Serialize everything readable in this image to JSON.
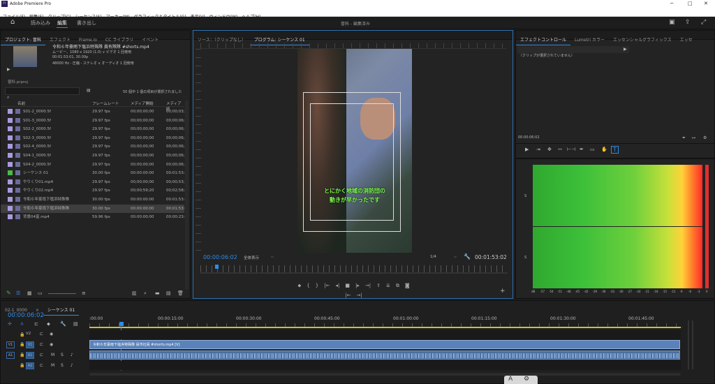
{
  "app": {
    "title": "Adobe Premiere Pro",
    "logo": "Pr"
  },
  "menus": [
    "ファイル(F)",
    "編集(E)",
    "クリップ(C)",
    "シーケンス(S)",
    "マーカー(M)",
    "グラフィックとタイトル(G)",
    "表示(V)",
    "ウィンドウ(W)",
    "ヘルプ(H)"
  ],
  "workspaces": [
    "読み込み",
    "編集",
    "書き出し"
  ],
  "active_workspace": "編集",
  "project_title": "曽科 - 編集済み",
  "project_panel": {
    "tabs": [
      "プロジェクト: 曽科",
      "エフェクト",
      "Frame.io",
      "CC ライブラリ",
      "イベント"
    ],
    "clip_name": "令和６年豪雨下塩浜特殊隊 員有隊隊 #shorts.mp4",
    "clip_info": [
      "ムービー、1080 x 1920 (1.0) ∨ ビデオ 1 回使用",
      "00:01:53:01, 30.00p",
      "48000 Hz - 圧縮 - ステレオ ∨ オーディオ 1 回使用"
    ],
    "project_file": "曽科.prproj",
    "status": "50 個中 1 個の項目が選択されました",
    "columns": [
      "名前",
      "フレームレート",
      "メディア開始",
      "メディア終"
    ],
    "items": [
      {
        "name": "S01-2_0000.5f",
        "fps": "29.97 fps",
        "start": "00;00;00;00",
        "end": "00;00;03;1",
        "color": "#a99ae0"
      },
      {
        "name": "S01-3_0000.5f",
        "fps": "29.97 fps",
        "start": "00;00;00;00",
        "end": "00;00;06;1",
        "color": "#a99ae0"
      },
      {
        "name": "S02-2_0000.5f",
        "fps": "29.97 fps",
        "start": "00;00;00;00",
        "end": "00;00;06;1",
        "color": "#a99ae0"
      },
      {
        "name": "S02-3_0000.5f",
        "fps": "29.97 fps",
        "start": "00;00;00;00",
        "end": "00;00;06;1",
        "color": "#a99ae0"
      },
      {
        "name": "S02-4_0000.5f",
        "fps": "29.97 fps",
        "start": "00;00;00;00",
        "end": "00;00;06;1",
        "color": "#a99ae0"
      },
      {
        "name": "S04-1_0000.5f",
        "fps": "29.97 fps",
        "start": "00;00;00;00",
        "end": "00;00;06;1",
        "color": "#a99ae0"
      },
      {
        "name": "S04-2_0000.5f",
        "fps": "29.97 fps",
        "start": "00;00;00;00",
        "end": "00;00;06;1",
        "color": "#a99ae0"
      },
      {
        "name": "シーケンス 01",
        "fps": "30.00 fps",
        "start": "00:00:00:00",
        "end": "00:01:53:0",
        "color": "#4ab84a"
      },
      {
        "name": "やりくり01.mp4",
        "fps": "29.97 fps",
        "start": "00;00;00;00",
        "end": "00;00;53;1",
        "color": "#a99ae0"
      },
      {
        "name": "やりくり02.mp4",
        "fps": "29.97 fps",
        "start": "00;00;59;20",
        "end": "00;02;58;0",
        "color": "#a99ae0"
      },
      {
        "name": "令和６年豪雨下塩浜特殊隊",
        "fps": "30.00 fps",
        "start": "00:00:00:00",
        "end": "00:01:53:0",
        "color": "#a99ae0"
      },
      {
        "name": "令和６年豪雨下塩浜特殊隊",
        "fps": "30.00 fps",
        "start": "00:00:00:00",
        "end": "00:01:53:0",
        "color": "#a99ae0",
        "selected": true
      },
      {
        "name": "背景04富.mp4",
        "fps": "59.96 fps",
        "start": "00:00:00:00",
        "end": "00:00:23:0",
        "color": "#a99ae0"
      }
    ]
  },
  "source_tab": "ソース：（クリップなし）",
  "program_tab": "プログラム: シーケンス 01",
  "program": {
    "timecode": "00:00:06:02",
    "fit": "全体表示",
    "quality": "1/4",
    "duration": "00:01:53:02",
    "caption_line1": "とにかく地域の消防団の",
    "caption_line2": "動きが早かったです"
  },
  "effect_controls": {
    "tabs": [
      "エフェクトコントロール",
      "Lumetri カラー",
      "エッセンシャルグラフィックス",
      "エッセ"
    ],
    "message": "（クリップが選択されていません）",
    "timecode": "00:00:06:02"
  },
  "timeline": {
    "tabs": [
      "02-1_0000",
      "シーケンス 01"
    ],
    "timecode": "00:00:06:02",
    "ruler": [
      ":00:00",
      "00:00:15:00",
      "00:00:30:00",
      "00:00:45:00",
      "00:01:00:00",
      "00:01:15:00",
      "00:01:30:00",
      "00:01:45:00"
    ],
    "tracks": [
      "V2",
      "V1",
      "A1",
      "A2"
    ],
    "clip_label": "令和６年豪雨下塩浜特殊隊 員市社員 #shorts.mp4 [V]"
  },
  "audio_meter": {
    "scale": [
      "dB",
      "-57",
      "-54",
      "-51",
      "-48",
      "-45",
      "-42",
      "-39",
      "-36",
      "-33",
      "-30",
      "-27",
      "-24",
      "-21",
      "-18",
      "-15",
      "-12",
      "-9",
      "-6",
      "-3",
      "0"
    ],
    "labels": [
      "S",
      "S"
    ]
  },
  "colors": {
    "accent": "#2d8ceb",
    "timecode": "#2d8ceb",
    "clip_video": "#5b82b8",
    "clip_audio": "#4a6fa0",
    "playhead": "#2d8ceb"
  }
}
